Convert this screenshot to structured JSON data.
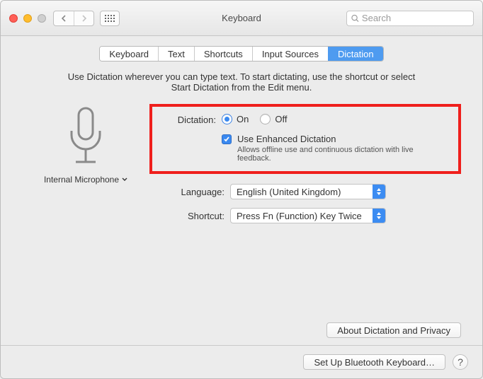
{
  "window": {
    "title": "Keyboard"
  },
  "search": {
    "placeholder": "Search"
  },
  "tabs": [
    {
      "label": "Keyboard"
    },
    {
      "label": "Text"
    },
    {
      "label": "Shortcuts"
    },
    {
      "label": "Input Sources"
    },
    {
      "label": "Dictation"
    }
  ],
  "intro": "Use Dictation wherever you can type text. To start dictating, use the shortcut or select Start Dictation from the Edit menu.",
  "mic": {
    "label": "Internal Microphone"
  },
  "dictation": {
    "label": "Dictation:",
    "on": "On",
    "off": "Off",
    "enhanced_label": "Use Enhanced Dictation",
    "enhanced_sub": "Allows offline use and continuous dictation with live feedback."
  },
  "language": {
    "label": "Language:",
    "value": "English (United Kingdom)"
  },
  "shortcut": {
    "label": "Shortcut:",
    "value": "Press Fn (Function) Key Twice"
  },
  "privacy_button": "About Dictation and Privacy",
  "bluetooth_button": "Set Up Bluetooth Keyboard…",
  "help": "?"
}
